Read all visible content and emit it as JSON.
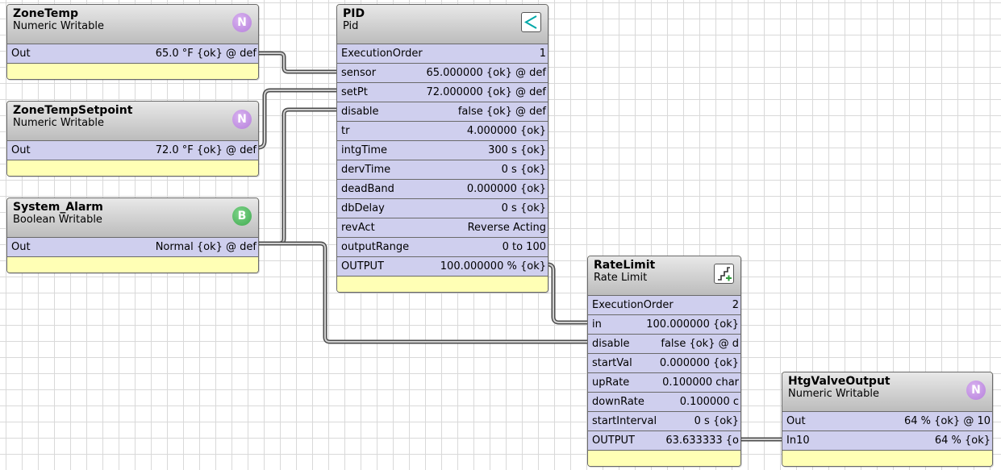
{
  "blocks": {
    "zone_temp": {
      "title": "ZoneTemp",
      "type": "Numeric Writable",
      "badge": "N",
      "slots": [
        {
          "name": "Out",
          "value": "65.0 °F {ok} @ def"
        }
      ]
    },
    "zone_temp_setpoint": {
      "title": "ZoneTempSetpoint",
      "type": "Numeric Writable",
      "badge": "N",
      "slots": [
        {
          "name": "Out",
          "value": "72.0 °F {ok} @ def"
        }
      ]
    },
    "system_alarm": {
      "title": "System_Alarm",
      "type": "Boolean Writable",
      "badge": "B",
      "slots": [
        {
          "name": "Out",
          "value": "Normal {ok} @ def"
        }
      ]
    },
    "pid": {
      "title": "PID",
      "type": "Pid",
      "icon": "pid-icon",
      "slots": [
        {
          "name": "ExecutionOrder",
          "value": "1"
        },
        {
          "name": "sensor",
          "value": "65.000000 {ok} @ def"
        },
        {
          "name": "setPt",
          "value": "72.000000 {ok} @ def"
        },
        {
          "name": "disable",
          "value": "false {ok} @ def"
        },
        {
          "name": "tr",
          "value": "4.000000 {ok}"
        },
        {
          "name": "intgTime",
          "value": "300 s {ok}"
        },
        {
          "name": "dervTime",
          "value": "0 s {ok}"
        },
        {
          "name": "deadBand",
          "value": "0.000000 {ok}"
        },
        {
          "name": "dbDelay",
          "value": "0 s {ok}"
        },
        {
          "name": "revAct",
          "value": "Reverse Acting"
        },
        {
          "name": "outputRange",
          "value": "0 to 100"
        },
        {
          "name": "OUTPUT",
          "value": "100.000000 % {ok}"
        }
      ]
    },
    "rate_limit": {
      "title": "RateLimit",
      "type": "Rate Limit",
      "icon": "rate-limit-icon",
      "slots": [
        {
          "name": "ExecutionOrder",
          "value": "2"
        },
        {
          "name": "in",
          "value": "100.000000 {ok}"
        },
        {
          "name": "disable",
          "value": "false {ok} @ d"
        },
        {
          "name": "startVal",
          "value": "0.000000 {ok}"
        },
        {
          "name": "upRate",
          "value": "0.100000 char"
        },
        {
          "name": "downRate",
          "value": "0.100000 c"
        },
        {
          "name": "startInterval",
          "value": "0 s {ok}"
        },
        {
          "name": "OUTPUT",
          "value": "63.633333 {o"
        }
      ]
    },
    "htg_valve_output": {
      "title": "HtgValveOutput",
      "type": "Numeric Writable",
      "badge": "N",
      "slots": [
        {
          "name": "Out",
          "value": "64 % {ok} @ 10"
        },
        {
          "name": "In10",
          "value": "64 % {ok}"
        }
      ]
    }
  },
  "colors": {
    "header_top": "#e8e8e8",
    "header_bottom": "#bcbcbc",
    "slot": "#cfcfee",
    "footer": "#ffffb5",
    "wire": "#555555",
    "numeric_badge": "#b57fdb",
    "boolean_badge": "#3faa4f"
  }
}
